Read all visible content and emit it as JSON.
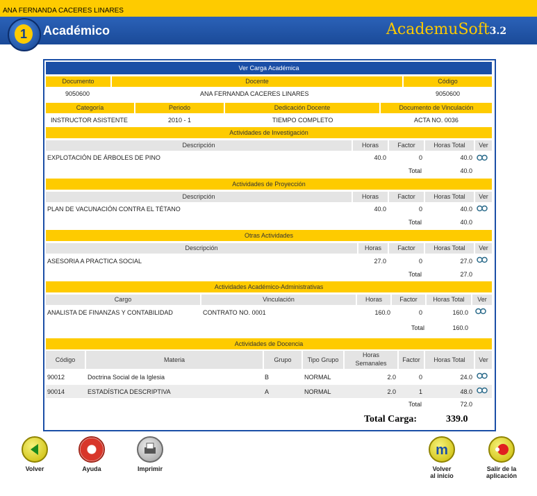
{
  "topbar": {
    "user": "ANA FERNANDA CACERES LINARES"
  },
  "header": {
    "title": "Académico",
    "brand": "AcademuSoft",
    "version": "3.2"
  },
  "page_title": "Ver Carga Académica",
  "info": {
    "h_documento": "Documento",
    "h_docente": "Docente",
    "h_codigo": "Código",
    "documento": "9050600",
    "docente": "ANA FERNANDA CACERES LINARES",
    "codigo": "9050600",
    "h_categoria": "Categoría",
    "h_periodo": "Periodo",
    "h_dedicacion": "Dedicación Docente",
    "h_vinculacion": "Documento de Vinculación",
    "categoria": "INSTRUCTOR ASISTENTE",
    "periodo": "2010 - 1",
    "dedicacion": "TIEMPO COMPLETO",
    "vinculacion": "ACTA NO. 0036"
  },
  "cols": {
    "descripcion": "Descripción",
    "horas": "Horas",
    "factor": "Factor",
    "horas_total": "Horas Total",
    "ver": "Ver",
    "total": "Total",
    "cargo": "Cargo",
    "vinculacion": "Vinculación",
    "codigo": "Código",
    "materia": "Materia",
    "grupo": "Grupo",
    "tipo_grupo": "Tipo Grupo",
    "horas_sem_1": "Horas",
    "horas_sem_2": "Semanales"
  },
  "investigacion": {
    "title": "Actividades de Investigación",
    "row": {
      "desc": "EXPLOTACIÓN DE ÁRBOLES DE PINO",
      "horas": "40.0",
      "factor": "0",
      "total": "40.0"
    },
    "total": "40.0"
  },
  "proyeccion": {
    "title": "Actividades de Proyección",
    "row": {
      "desc": "PLAN DE VACUNACIÓN CONTRA EL TÉTANO",
      "horas": "40.0",
      "factor": "0",
      "total": "40.0"
    },
    "total": "40.0"
  },
  "otras": {
    "title": "Otras Actividades",
    "row": {
      "desc": "ASESORIA A PRACTICA SOCIAL",
      "horas": "27.0",
      "factor": "0",
      "total": "27.0"
    },
    "total": "27.0"
  },
  "admin": {
    "title": "Actividades Académico-Administrativas",
    "row": {
      "cargo": "ANALISTA DE FINANZAS Y CONTABILIDAD",
      "vinc": "CONTRATO NO. 0001",
      "horas": "160.0",
      "factor": "0",
      "total": "160.0"
    },
    "total": "160.0"
  },
  "docencia": {
    "title": "Actividades de Docencia",
    "rows": [
      {
        "codigo": "90012",
        "materia": "Doctrina Social de la Iglesia",
        "grupo": "B",
        "tipo": "NORMAL",
        "horas": "2.0",
        "factor": "0",
        "total": "24.0"
      },
      {
        "codigo": "90014",
        "materia": "ESTADÍSTICA DESCRIPTIVA",
        "grupo": "A",
        "tipo": "NORMAL",
        "horas": "2.0",
        "factor": "1",
        "total": "48.0"
      }
    ],
    "total": "72.0"
  },
  "total_carga": {
    "label": "Total Carga:",
    "value": "339.0"
  },
  "buttons": {
    "volver": "Volver",
    "ayuda": "Ayuda",
    "imprimir": "Imprimir",
    "inicio_1": "Volver",
    "inicio_2": "al inicio",
    "salir_1": "Salir de la",
    "salir_2": "aplicación"
  },
  "colors": {
    "yellow": "#fecb00",
    "blue": "#1a4ea6"
  }
}
